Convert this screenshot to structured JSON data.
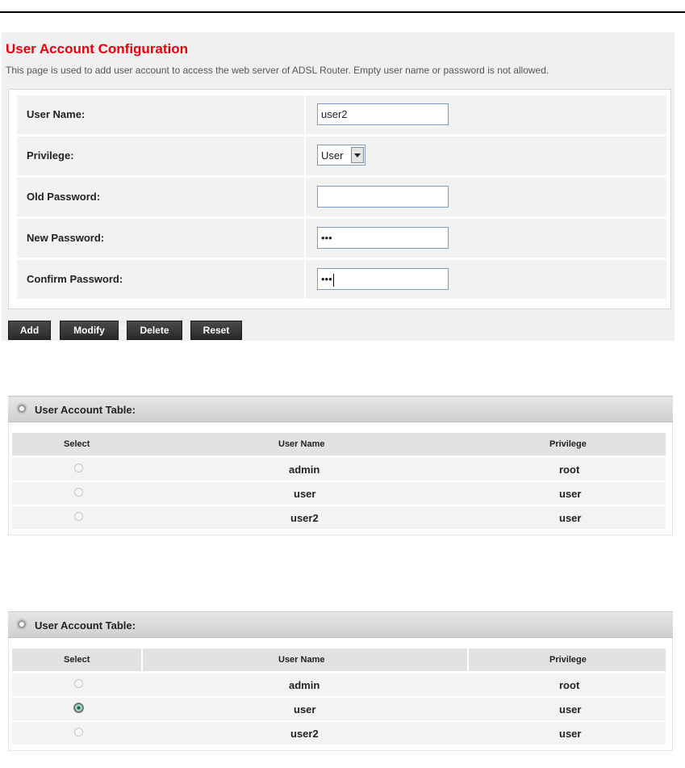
{
  "config": {
    "title": "User Account Configuration",
    "description": "This page is used to add user account to access the web server of ADSL Router. Empty user name or password is not allowed.",
    "fields": {
      "username_label": "User Name:",
      "username_value": "user2",
      "privilege_label": "Privilege:",
      "privilege_value": "User",
      "old_password_label": "Old Password:",
      "old_password_value": "",
      "new_password_label": "New Password:",
      "new_password_masked": "•••",
      "confirm_password_label": "Confirm Password:",
      "confirm_password_masked": "•••"
    },
    "buttons": {
      "add": "Add",
      "modify": "Modify",
      "delete": "Delete",
      "reset": "Reset"
    }
  },
  "tables": [
    {
      "title": "User Account Table:",
      "headers": {
        "select": "Select",
        "username": "User Name",
        "privilege": "Privilege"
      },
      "rows": [
        {
          "username": "admin",
          "privilege": "root",
          "selected": false
        },
        {
          "username": "user",
          "privilege": "user",
          "selected": false
        },
        {
          "username": "user2",
          "privilege": "user",
          "selected": false
        }
      ]
    },
    {
      "title": "User Account Table:",
      "headers": {
        "select": "Select",
        "username": "User Name",
        "privilege": "Privilege"
      },
      "rows": [
        {
          "username": "admin",
          "privilege": "root",
          "selected": false
        },
        {
          "username": "user",
          "privilege": "user",
          "selected": true
        },
        {
          "username": "user2",
          "privilege": "user",
          "selected": false
        }
      ]
    }
  ],
  "colors": {
    "title_red": "#e8000b",
    "button_dark": "#383838",
    "row_bg": "#f2f2f2"
  },
  "icons": {
    "table_header": "gear-icon",
    "dropdown": "chevron-down-icon"
  }
}
